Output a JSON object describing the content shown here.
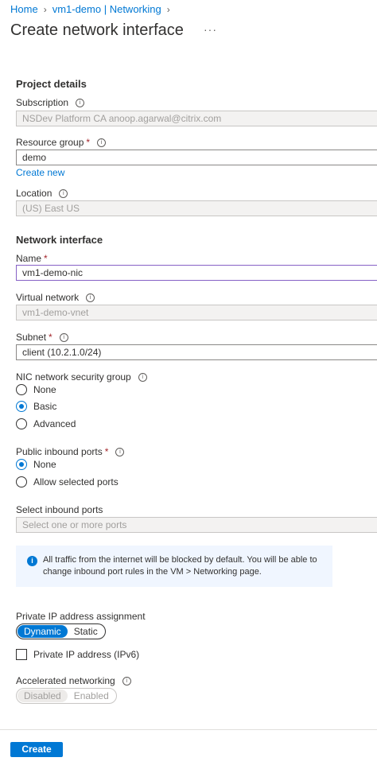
{
  "breadcrumb": {
    "items": [
      "Home",
      "vm1-demo | Networking"
    ]
  },
  "page": {
    "title": "Create network interface",
    "more_label": "···"
  },
  "project": {
    "heading": "Project details",
    "subscription": {
      "label": "Subscription",
      "value": "NSDev Platform CA anoop.agarwal@citrix.com"
    },
    "resource_group": {
      "label": "Resource group",
      "value": "demo",
      "create_new": "Create new"
    },
    "location": {
      "label": "Location",
      "value": "(US) East US"
    }
  },
  "network": {
    "heading": "Network interface",
    "name": {
      "label": "Name",
      "value": "vm1-demo-nic"
    },
    "vnet": {
      "label": "Virtual network",
      "value": "vm1-demo-vnet"
    },
    "subnet": {
      "label": "Subnet",
      "value": "client (10.2.1.0/24)"
    },
    "nsg": {
      "label": "NIC network security group",
      "options": [
        "None",
        "Basic",
        "Advanced"
      ],
      "selected": "Basic"
    },
    "public_ports": {
      "label": "Public inbound ports",
      "options": [
        "None",
        "Allow selected ports"
      ],
      "selected": "None"
    },
    "inbound_ports": {
      "label": "Select inbound ports",
      "placeholder": "Select one or more ports"
    },
    "info_message": "All traffic from the internet will be blocked by default. You will be able to change inbound port rules in the VM > Networking page.",
    "ip_assignment": {
      "label": "Private IP address assignment",
      "options": [
        "Dynamic",
        "Static"
      ],
      "selected": "Dynamic"
    },
    "ipv6": {
      "label": "Private IP address (IPv6)",
      "checked": false
    },
    "accelerated": {
      "label": "Accelerated networking",
      "options": [
        "Disabled",
        "Enabled"
      ],
      "selected": "Disabled"
    }
  },
  "footer": {
    "create_label": "Create"
  },
  "colors": {
    "accent": "#0078d4",
    "required": "#a4262c",
    "focus_border": "#8661c5",
    "info_bg": "#f0f6ff"
  },
  "icons": {
    "info": "info-icon",
    "chevron": "chevron-right-icon",
    "more": "more-icon"
  }
}
